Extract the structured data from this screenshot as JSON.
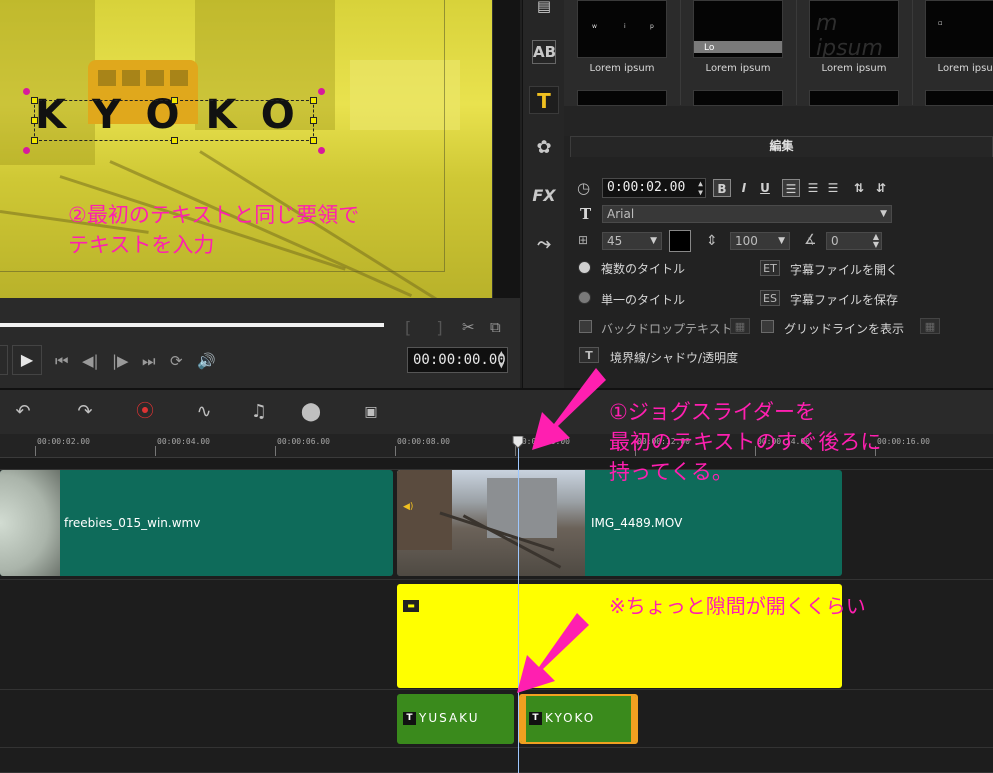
{
  "preview": {
    "title_text": "KYOKO",
    "annotation_line1": "②最初のテキストと同じ要領で",
    "annotation_line2": "テキストを入力",
    "mark_in": "[",
    "mark_out": "]",
    "timecode": "00:00:00.00"
  },
  "side_toolbar": {
    "icons": [
      "media-fx-icon",
      "transition-ab-icon",
      "title-icon",
      "graphics-icon",
      "filter-fx-icon",
      "path-icon"
    ],
    "transition_label": "AB",
    "fx_label": "FX",
    "title_label": "T"
  },
  "library": {
    "thumb_labels": [
      "Lorem ipsum",
      "Lorem ipsum",
      "Lorem ipsum",
      "Lorem ipsum"
    ],
    "thumb2_caption": "Lo",
    "thumb3_caption": "m ipsum"
  },
  "edit_panel": {
    "tab": "編集",
    "duration": "0:00:02.00",
    "bold": "B",
    "italic": "I",
    "underline": "U",
    "font": "Arial",
    "font_size": "45",
    "line_spacing": "100",
    "angle": "0",
    "multi_title": "複数のタイトル",
    "single_title": "単一のタイトル",
    "open_subtitle": "字幕ファイルを開く",
    "save_subtitle": "字幕ファイルを保存",
    "backdrop": "バックドロップテキスト",
    "gridlines": "グリッドラインを表示",
    "border_shadow": "境界線/シャドウ/透明度",
    "text_color": "#000000"
  },
  "timeline": {
    "ruler": [
      "00:00:02.00",
      "00:00:04.00",
      "00:00:06.00",
      "00:00:08.00",
      "00:00:10.00",
      "00:00:12.00",
      "00:00:14.00",
      "00:00:16.00"
    ],
    "clips": {
      "video1": "freebies_015_win.wmv",
      "video2": "IMG_4489.MOV",
      "title1": "YUSAKU",
      "title2": "KYOKO"
    },
    "annotation1_line1": "①ジョグスライダーを",
    "annotation1_line2": "最初のテキストのすぐ後ろに",
    "annotation1_line3": "持ってくる。",
    "annotation2": "※ちょっと隙間が開くくらい"
  },
  "colors": {
    "annotation": "#ff1fb0",
    "clip_video": "#0e6b5a",
    "clip_overlay": "#ffff00",
    "clip_title": "#3a8a1c",
    "selection_border": "#f0a020"
  }
}
